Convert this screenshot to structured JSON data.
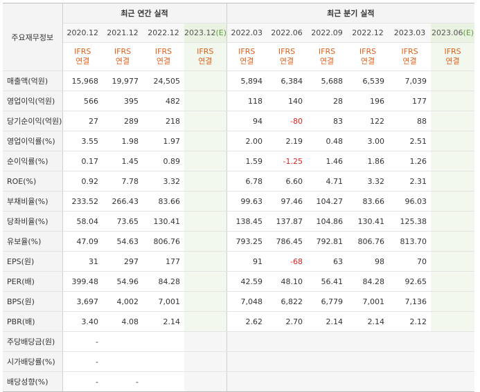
{
  "header": {
    "corner": "주요재무정보",
    "annual_title": "최근 연간 실적",
    "quarter_title": "최근 분기 실적",
    "annual_periods": [
      "2020.12",
      "2021.12",
      "2022.12",
      "2023.12"
    ],
    "annual_est": "(E)",
    "quarter_periods": [
      "2022.03",
      "2022.06",
      "2022.09",
      "2022.12",
      "2023.03",
      "2023.06"
    ],
    "quarter_est": "(E)",
    "ifrs_line1": "IFRS",
    "ifrs_line2": "연결"
  },
  "rows": [
    {
      "label": "매출액(억원)",
      "annual": [
        "15,968",
        "19,977",
        "24,505",
        ""
      ],
      "quarter": [
        "5,894",
        "6,384",
        "5,688",
        "6,539",
        "7,039",
        ""
      ]
    },
    {
      "label": "영업이익(억원)",
      "annual": [
        "566",
        "395",
        "482",
        ""
      ],
      "quarter": [
        "118",
        "140",
        "28",
        "196",
        "177",
        ""
      ]
    },
    {
      "label": "당기순이익(억원)",
      "annual": [
        "27",
        "289",
        "218",
        ""
      ],
      "quarter": [
        "94",
        "-80",
        "83",
        "122",
        "88",
        ""
      ]
    },
    {
      "label": "영업이익률(%)",
      "annual": [
        "3.55",
        "1.98",
        "1.97",
        ""
      ],
      "quarter": [
        "2.00",
        "2.19",
        "0.48",
        "3.00",
        "2.51",
        ""
      ]
    },
    {
      "label": "순이익률(%)",
      "annual": [
        "0.17",
        "1.45",
        "0.89",
        ""
      ],
      "quarter": [
        "1.59",
        "-1.25",
        "1.46",
        "1.86",
        "1.26",
        ""
      ]
    },
    {
      "label": "ROE(%)",
      "annual": [
        "0.92",
        "7.78",
        "3.32",
        ""
      ],
      "quarter": [
        "6.78",
        "6.60",
        "4.71",
        "3.32",
        "2.31",
        ""
      ]
    },
    {
      "label": "부채비율(%)",
      "annual": [
        "233.52",
        "266.43",
        "83.66",
        ""
      ],
      "quarter": [
        "99.63",
        "97.46",
        "104.27",
        "83.66",
        "96.03",
        ""
      ]
    },
    {
      "label": "당좌비율(%)",
      "annual": [
        "58.04",
        "73.65",
        "130.41",
        ""
      ],
      "quarter": [
        "138.45",
        "137.87",
        "104.86",
        "130.41",
        "125.38",
        ""
      ]
    },
    {
      "label": "유보율(%)",
      "annual": [
        "47.09",
        "54.63",
        "806.76",
        ""
      ],
      "quarter": [
        "793.25",
        "786.45",
        "792.81",
        "806.76",
        "813.70",
        ""
      ]
    },
    {
      "label": "EPS(원)",
      "annual": [
        "31",
        "297",
        "177",
        ""
      ],
      "quarter": [
        "91",
        "-68",
        "63",
        "98",
        "70",
        ""
      ]
    },
    {
      "label": "PER(배)",
      "annual": [
        "399.48",
        "54.96",
        "84.28",
        ""
      ],
      "quarter": [
        "42.59",
        "48.10",
        "56.41",
        "84.28",
        "92.65",
        ""
      ]
    },
    {
      "label": "BPS(원)",
      "annual": [
        "3,697",
        "4,002",
        "7,001",
        ""
      ],
      "quarter": [
        "7,048",
        "6,822",
        "6,779",
        "7,001",
        "7,136",
        ""
      ]
    },
    {
      "label": "PBR(배)",
      "annual": [
        "3.40",
        "4.08",
        "2.14",
        ""
      ],
      "quarter": [
        "2.62",
        "2.70",
        "2.14",
        "2.14",
        "2.12",
        ""
      ]
    },
    {
      "label": "주당배당금(원)",
      "annual": [
        "-",
        "",
        "",
        ""
      ],
      "quarter": [
        "",
        "",
        "",
        "",
        "",
        ""
      ]
    },
    {
      "label": "시가배당률(%)",
      "annual": [
        "-",
        "",
        "",
        ""
      ],
      "quarter": [
        "",
        "",
        "",
        "",
        "",
        ""
      ]
    },
    {
      "label": "배당성향(%)",
      "annual": [
        "-",
        "-",
        "",
        ""
      ],
      "quarter": [
        "",
        "",
        "",
        "",
        "",
        ""
      ]
    }
  ]
}
